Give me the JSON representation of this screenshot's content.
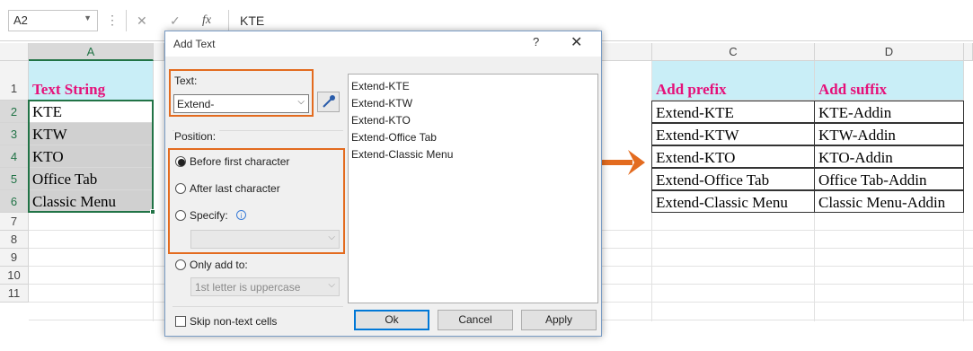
{
  "formula_bar": {
    "name_box": "A2",
    "dots": "⋮",
    "cancel_glyph": "✕",
    "enter_glyph": "✓",
    "fx_glyph": "fx",
    "content": "KTE"
  },
  "sheet": {
    "columns": [
      "A",
      "C",
      "D"
    ],
    "rows": [
      "1",
      "2",
      "3",
      "4",
      "5",
      "6",
      "7",
      "8",
      "9",
      "10",
      "11"
    ],
    "col_a": [
      "Text String",
      "KTE",
      "KTW",
      "KTO",
      "Office Tab",
      "Classic Menu"
    ],
    "col_c": [
      "Add prefix",
      "Extend-KTE",
      "Extend-KTW",
      "Extend-KTO",
      "Extend-Office Tab",
      "Extend-Classic Menu"
    ],
    "col_d": [
      "Add suffix",
      "KTE-Addin",
      "KTW-Addin",
      "KTO-Addin",
      "Office Tab-Addin",
      "Classic Menu-Addin"
    ],
    "header_fill": "#c9eef7",
    "header_text_color": "#e5117a"
  },
  "dialog": {
    "title": "Add Text",
    "help": "?",
    "close": "✕",
    "text_label": "Text:",
    "text_value": "Extend-",
    "position_label": "Position:",
    "options": [
      "Before first character",
      "After last character",
      "Specify:"
    ],
    "selected_option": "Before first character",
    "specify_value": "",
    "only_add_label": "Only add to:",
    "only_add_value": "1st letter is uppercase",
    "skip_label": "Skip non-text cells",
    "preview": [
      "Extend-KTE",
      "Extend-KTW",
      "Extend-KTO",
      "Extend-Office Tab",
      "Extend-Classic Menu"
    ],
    "buttons": {
      "ok": "Ok",
      "cancel": "Cancel",
      "apply": "Apply"
    },
    "highlight_color": "#e36b1f"
  }
}
